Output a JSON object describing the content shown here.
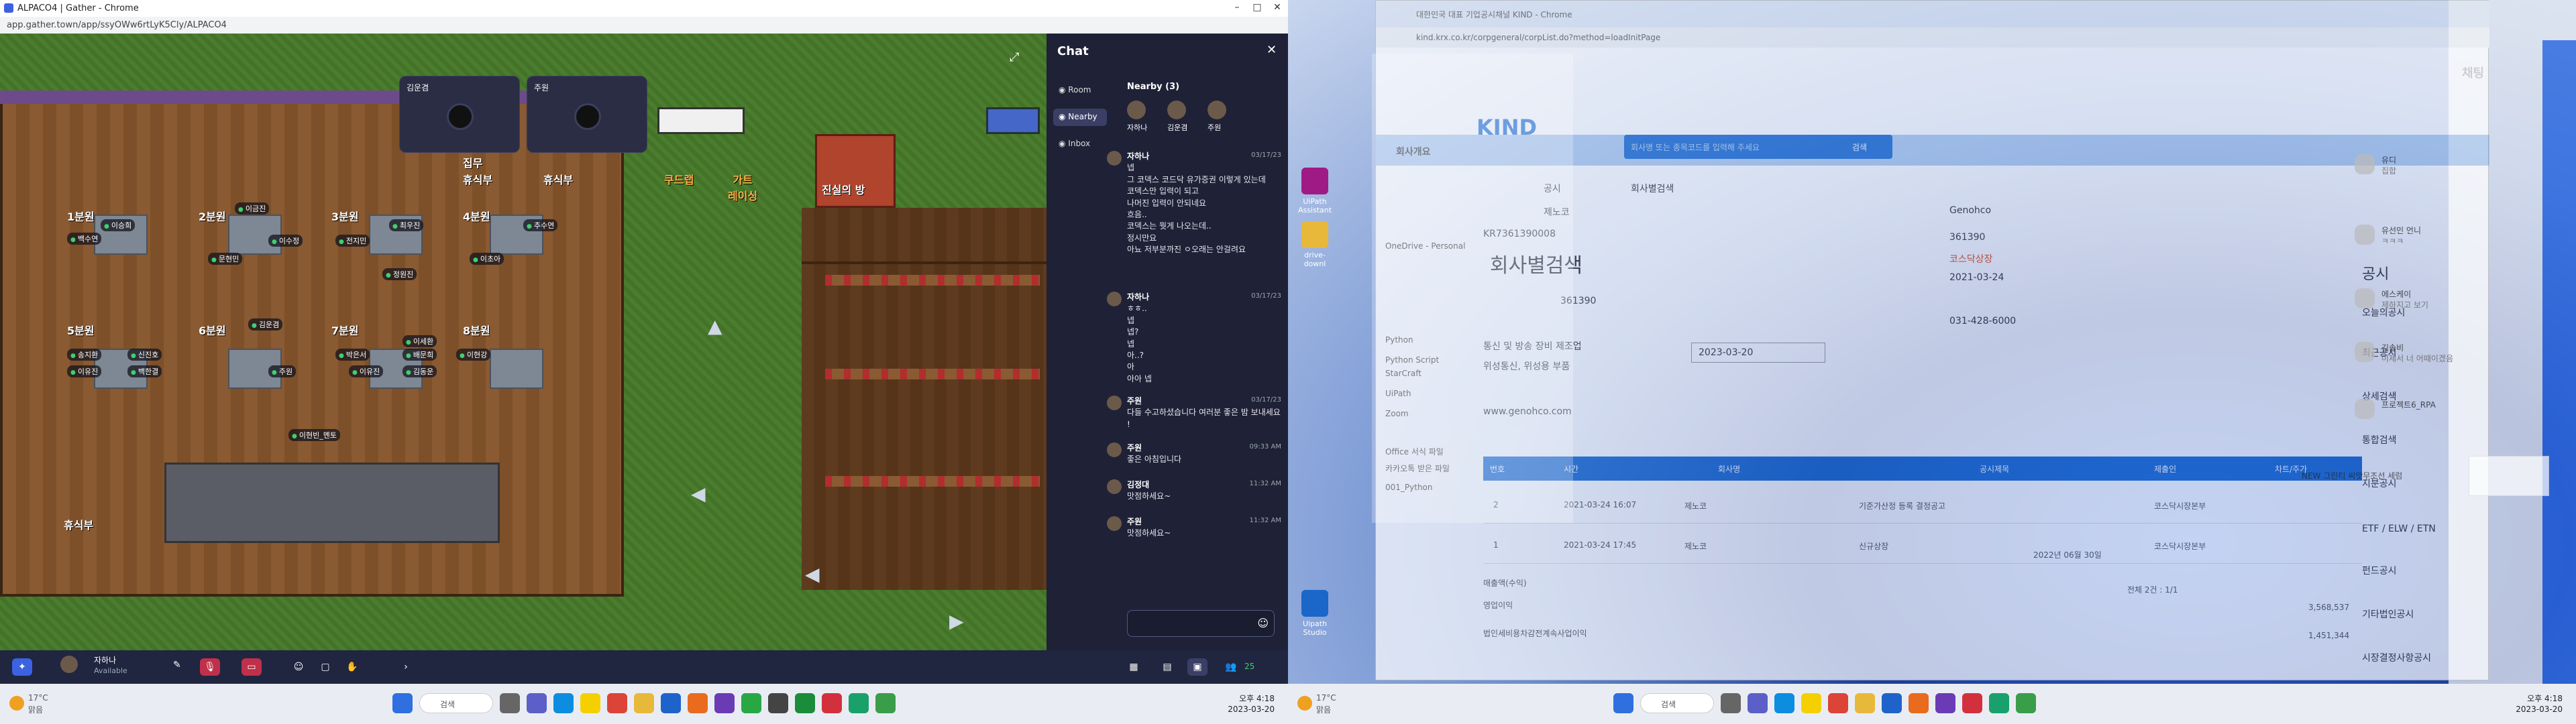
{
  "left_monitor": {
    "window_title": "ALPACO4 | Gather - Chrome",
    "url": "app.gather.town/app/ssyOWw6rtLyK5Cly/ALPACO4",
    "video_tiles": [
      {
        "name": "김운겸"
      },
      {
        "name": "주원"
      }
    ],
    "zones": {
      "z1": "1분원",
      "z2": "2분원",
      "z3": "3분원",
      "z4": "4분원",
      "z5": "5분원",
      "z6": "6분원",
      "z7": "7분원",
      "z8": "8분원",
      "s1": "집무",
      "s2": "휴식부",
      "s3": "휴식부",
      "coffee": "쿠드랩",
      "game": "가트\n레이싱",
      "secret": "진실의 방",
      "rest": "휴식부",
      "desk": "휴식"
    },
    "avatars": [
      "이승희",
      "백수연",
      "이금진",
      "문현민",
      "이수정",
      "전지민",
      "최우진",
      "정원진",
      "추수연",
      "이초아",
      "김운겸",
      "송지환",
      "이유진",
      "신진호",
      "백한결",
      "박은서",
      "배문희",
      "이세환",
      "이유진",
      "이현강",
      "주원",
      "이현빈_멘토",
      "김동운"
    ],
    "chat": {
      "title": "Chat",
      "tabs": [
        "Room",
        "Nearby",
        "Inbox"
      ],
      "nearby_header": "Nearby (3)",
      "nearby_people": [
        "자하나",
        "김운겸",
        "주원"
      ],
      "messages": [
        {
          "who": "자하나",
          "time": "03/17/23",
          "text": "넵\n그 코덱스 코드닥 유가증권 이렇게 있는데\n코덱스만 입력이 되고\n나머진 입력이 안되네요\n흐음..\n코덱스는 뭣게 나오는데..\n정시만요\n아뇨 저부분까진 ㅇ오래는 안걸려요"
        },
        {
          "who": "자하나",
          "time": "03/17/23",
          "text": "ㅎㅎ..\n넵\n넵?\n넵\n아..?\n아\n아아 넵"
        },
        {
          "who": "주원",
          "time": "03/17/23",
          "text": "다들 수고하셨습니다 여러분 좋은 밤 보내세요 !"
        },
        {
          "who": "주원",
          "time": "09:33 AM",
          "text": "좋은 아침입니다"
        },
        {
          "who": "김정대",
          "time": "11:32 AM",
          "text": "맛점하세요~"
        },
        {
          "who": "주원",
          "time": "11:32 AM",
          "text": "맛점하세요~"
        }
      ]
    },
    "bottom_bar": {
      "user": "자하나",
      "status": "Available",
      "count": "25"
    },
    "taskbar": {
      "weather": "17°C",
      "weather_sub": "맑음",
      "search": "검색",
      "time": "오후 4:18",
      "date": "2023-03-20"
    }
  },
  "right_monitor": {
    "window_title": "대한민국 대표 기업공시채널 KIND - Chrome",
    "url": "kind.krx.co.kr/corpgeneral/corpList.do?method=loadInitPage",
    "kind": {
      "logo": "KIND",
      "search_placeholder": "회사명 또는 종목코드를 입력해 주세요",
      "search_btn": "검색",
      "nav": [
        "회사개요",
        "공시",
        "회사별검색"
      ],
      "page_title": "회사별검색",
      "company": {
        "name": "제노코",
        "code": "KR7361390008",
        "code_short": "361390",
        "listing": "코스닥상장",
        "date": "2021-03-24",
        "industry": "통신 및 방송 장비 제조업",
        "product": "위성통신, 위성용 부품",
        "homepage": "www.genohco.com",
        "phone": "031-428-6000",
        "eng": "Genohco"
      },
      "date_from": "2023-03-20",
      "table_head": [
        "번호",
        "시간",
        "회사명",
        "공시제목",
        "제출인",
        "차트/주가"
      ],
      "rows": [
        {
          "no": "2",
          "time": "2021-03-24 16:07",
          "company": "제노코",
          "title": "기준가산정 등록 결정공고",
          "by": "코스닥시장본부"
        },
        {
          "no": "1",
          "time": "2021-03-24 17:45",
          "company": "제노코",
          "title": "신규상장",
          "by": "코스닥시장본부"
        }
      ],
      "page_info": "전체 2건 : 1/1",
      "bottom_items": [
        "매출액(수익)",
        "영업이익",
        "법인세비용차감전계속사업이익"
      ],
      "bottom_values": [
        "3,568,537",
        "1,451,344"
      ],
      "year_note": "2022년 06월 30일"
    },
    "explorer": {
      "items": [
        "OneDrive - Personal",
        "Python",
        "StarCraft",
        "UiPath",
        "Zoom",
        "Python Script",
        "Office 서식 파일",
        "카카오톡 받은 파일",
        "001_Python"
      ]
    },
    "katalk": {
      "title": "채팅",
      "chats": [
        {
          "name": "유디",
          "msg": "집합"
        },
        {
          "name": "유선민 언니",
          "msg": "ㅋㅋㅋ"
        },
        {
          "name": "에스케이",
          "msg": "제하지고 보기"
        },
        {
          "name": "김솔비",
          "msg": "이제서 너 어때이겠음"
        },
        {
          "name": "프로젝트6_RPA",
          "msg": ""
        }
      ],
      "ad": "NEW 그린티 씨앗무조선 세럼"
    },
    "side_menu": [
      "공시",
      "오늘의공시",
      "최근공시",
      "상세검색",
      "통합검색",
      "지분공시",
      "ETF / ELW / ETN",
      "펀드공시",
      "기타법인공시",
      "시장결정사항공시"
    ],
    "desktop_icons": [
      "UiPath Assistant",
      "Uipath Studio",
      "drive-downl"
    ],
    "taskbar": {
      "weather": "17°C",
      "weather_sub": "맑음",
      "search": "검색",
      "time": "오후 4:18",
      "date": "2023-03-20"
    }
  }
}
